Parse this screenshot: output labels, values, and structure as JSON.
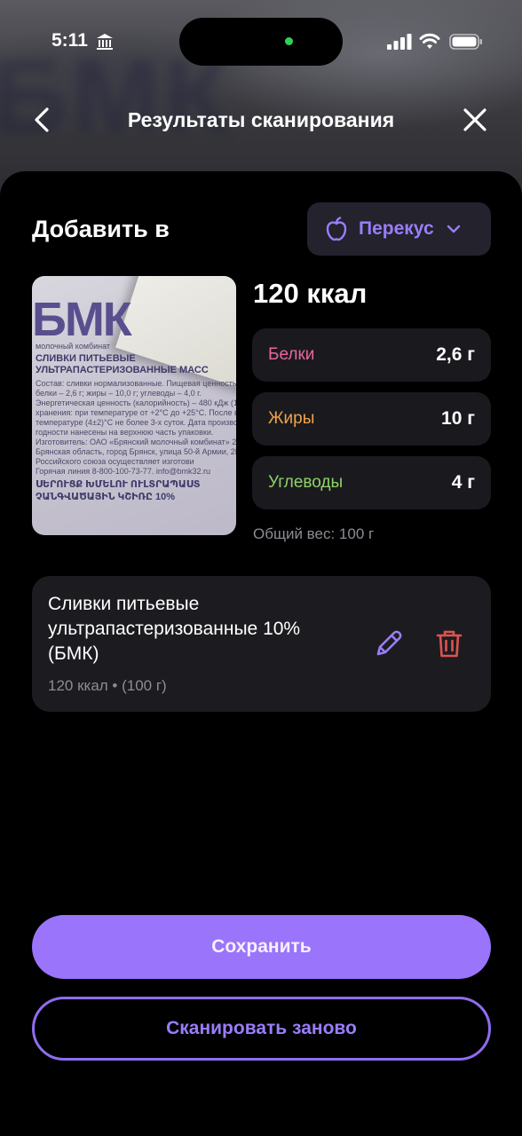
{
  "status_bar": {
    "time": "5:11"
  },
  "header": {
    "title": "Результаты сканирования"
  },
  "add_section": {
    "label": "Добавить в",
    "meal": {
      "label": "Перекус",
      "icon": "apple-icon",
      "color": "#9a7dfa"
    }
  },
  "photo": {
    "logo": "БМК",
    "lines": [
      "молочный комбинат",
      "СЛИВКИ ПИТЬЕВЫЕ",
      "УЛЬТРАПАСТЕРИЗОВАННЫЕ МАСС",
      "Состав: сливки нормализованные. Пищевая ценность на 10",
      "белки – 2,6 г; жиры – 10,0 г; углеводы – 4,0 г.",
      "Энергетическая ценность (калорийность) – 480 кДж (120 ккал",
      "хранения: при температуре от +2°C до +25°C. После вскрыти",
      "температуре (4±2)°C не более 3-х суток. Дата производства",
      "годности нанесены на верхнюю часть упаковки.",
      "Изготовитель: ОАО «Брянский молочный комбинат» 241027",
      "Брянская область, город Брянск, улица 50-й Армии, 2Б.",
      "Российского союза осуществляет изготови",
      "Горячая линия 8-800-100-73-77. info@bmk32.ru",
      "ՍԵՐՈՒՑՔ ԽՄԵԼՈՒ ՈՒԼՏՐԱՊԱՍՏ",
      "ՉԱՆԳՎԱԾԱՅԻՆ ԿՇԻՌԸ 10%"
    ]
  },
  "nutrition": {
    "kcal": "120 ккал",
    "macros": [
      {
        "name": "Белки",
        "value": "2,6 г",
        "color": "#e8679f"
      },
      {
        "name": "Жиры",
        "value": "10 г",
        "color": "#f0a24a"
      },
      {
        "name": "Углеводы",
        "value": "4 г",
        "color": "#8fd16a"
      }
    ],
    "total_weight": "Общий вес: 100 г"
  },
  "product": {
    "name": "Сливки питьевые ультрапастеризованные 10% (БМК)",
    "subtitle": "120 ккал • (100 г)",
    "edit_icon": "pencil-icon",
    "delete_icon": "trash-icon",
    "edit_color": "#9a7dfa",
    "delete_color": "#e0524f"
  },
  "actions": {
    "save": "Сохранить",
    "rescan": "Сканировать заново"
  }
}
